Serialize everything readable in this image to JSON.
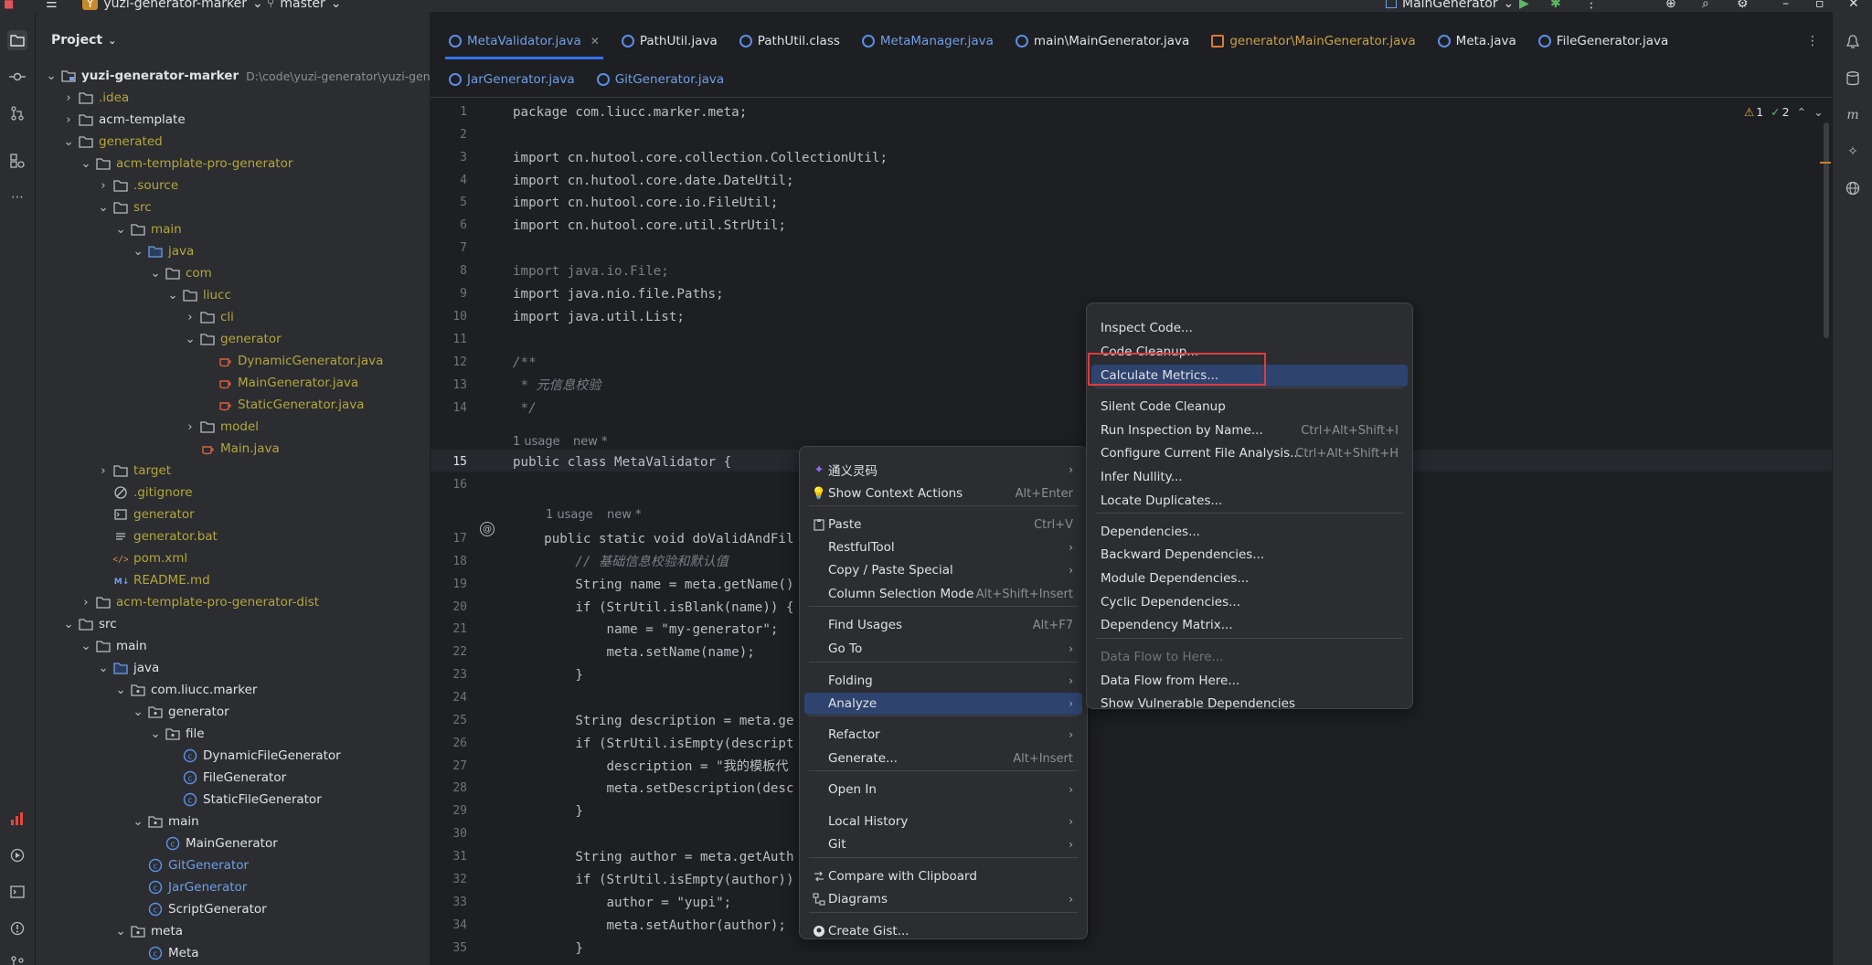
{
  "titlebar": {
    "project_badge": "Y",
    "project_name": "yuzi-generator-marker",
    "branch": "master",
    "run_config": "MainGenerator"
  },
  "project_panel": {
    "title": "Project",
    "root_name": "yuzi-generator-marker",
    "root_path": "D:\\code\\yuzi-generator\\yuzi-genera",
    "items": [
      {
        "label": ".idea",
        "color": "yellow"
      },
      {
        "label": "acm-template",
        "color": "normal"
      },
      {
        "label": "generated",
        "color": "yellow"
      },
      {
        "label": "acm-template-pro-generator",
        "color": "yellow"
      },
      {
        "label": ".source",
        "color": "yellow"
      },
      {
        "label": "src",
        "color": "yellow"
      },
      {
        "label": "main",
        "color": "yellow"
      },
      {
        "label": "java",
        "color": "yellow"
      },
      {
        "label": "com",
        "color": "yellow"
      },
      {
        "label": "liucc",
        "color": "yellow"
      },
      {
        "label": "cli",
        "color": "yellow"
      },
      {
        "label": "generator",
        "color": "yellow"
      },
      {
        "label": "DynamicGenerator.java",
        "color": "yellow"
      },
      {
        "label": "MainGenerator.java",
        "color": "yellow"
      },
      {
        "label": "StaticGenerator.java",
        "color": "yellow"
      },
      {
        "label": "model",
        "color": "yellow"
      },
      {
        "label": "Main.java",
        "color": "yellow"
      },
      {
        "label": "target",
        "color": "yellow"
      },
      {
        "label": ".gitignore",
        "color": "yellow"
      },
      {
        "label": "generator",
        "color": "yellow"
      },
      {
        "label": "generator.bat",
        "color": "yellow"
      },
      {
        "label": "pom.xml",
        "color": "yellow"
      },
      {
        "label": "README.md",
        "color": "yellow"
      },
      {
        "label": "acm-template-pro-generator-dist",
        "color": "yellow"
      },
      {
        "label": "src",
        "color": "normal"
      },
      {
        "label": "main",
        "color": "normal"
      },
      {
        "label": "java",
        "color": "normal"
      },
      {
        "label": "com.liucc.marker",
        "color": "normal"
      },
      {
        "label": "generator",
        "color": "normal"
      },
      {
        "label": "file",
        "color": "normal"
      },
      {
        "label": "DynamicFileGenerator",
        "color": "normal"
      },
      {
        "label": "FileGenerator",
        "color": "normal"
      },
      {
        "label": "StaticFileGenerator",
        "color": "normal"
      },
      {
        "label": "main",
        "color": "normal"
      },
      {
        "label": "MainGenerator",
        "color": "normal"
      },
      {
        "label": "GitGenerator",
        "color": "blue"
      },
      {
        "label": "JarGenerator",
        "color": "blue"
      },
      {
        "label": "ScriptGenerator",
        "color": "normal"
      },
      {
        "label": "meta",
        "color": "normal"
      },
      {
        "label": "Meta",
        "color": "normal"
      }
    ]
  },
  "tabs_row1": [
    {
      "label": "MetaValidator.java",
      "active": true,
      "color": "blue"
    },
    {
      "label": "PathUtil.java",
      "color": "normal"
    },
    {
      "label": "PathUtil.class",
      "color": "normal"
    },
    {
      "label": "MetaManager.java",
      "color": "blue"
    },
    {
      "label": "main\\MainGenerator.java",
      "color": "normal"
    },
    {
      "label": "generator\\MainGenerator.java",
      "color": "gold"
    },
    {
      "label": "Meta.java",
      "color": "normal"
    },
    {
      "label": "FileGenerator.java",
      "color": "normal"
    }
  ],
  "tabs_row2": [
    {
      "label": "JarGenerator.java",
      "color": "blue"
    },
    {
      "label": "GitGenerator.java",
      "color": "blue"
    }
  ],
  "editor": {
    "warnings": "1",
    "checks": "2",
    "usage1": "1 usage",
    "new1": "new *",
    "usage2": "1 usage",
    "new2": "new *",
    "lines": {
      "l1": "package com.liucc.marker.meta;",
      "l3": "import cn.hutool.core.collection.CollectionUtil;",
      "l4": "import cn.hutool.core.date.DateUtil;",
      "l5": "import cn.hutool.core.io.FileUtil;",
      "l6": "import cn.hutool.core.util.StrUtil;",
      "l8": "import java.io.File;",
      "l9": "import java.nio.file.Paths;",
      "l10": "import java.util.List;",
      "l12": "/**",
      "l13": " * 元信息校验",
      "l14": " */",
      "l15": "public class MetaValidator {",
      "l17": "    public static void doValidAndFil",
      "l18": "        // 基础信息校验和默认值",
      "l19": "        String name = meta.getName()",
      "l20": "        if (StrUtil.isBlank(name)) {",
      "l21": "            name = \"my-generator\";",
      "l22": "            meta.setName(name);",
      "l23": "        }",
      "l25": "        String description = meta.ge",
      "l26": "        if (StrUtil.isEmpty(descript",
      "l27": "            description = \"我的模板代",
      "l28": "            meta.setDescription(desc",
      "l29": "        }",
      "l31": "        String author = meta.getAuth",
      "l32": "        if (StrUtil.isEmpty(author))",
      "l33": "            author = \"yupi\";",
      "l34": "            meta.setAuthor(author);",
      "l35": "        }"
    }
  },
  "context_menu": {
    "items": [
      {
        "label": "通义灵码",
        "shortcut": "",
        "submenu": true,
        "icon": "tongyi-icon"
      },
      {
        "label": "Show Context Actions",
        "shortcut": "Alt+Enter",
        "icon": "bulb-icon"
      },
      {
        "label": "Paste",
        "shortcut": "Ctrl+V",
        "icon": "clipboard-icon"
      },
      {
        "label": "RestfulTool",
        "submenu": true
      },
      {
        "label": "Copy / Paste Special",
        "submenu": true
      },
      {
        "label": "Column Selection Mode",
        "shortcut": "Alt+Shift+Insert"
      },
      {
        "label": "Find Usages",
        "shortcut": "Alt+F7"
      },
      {
        "label": "Go To",
        "submenu": true
      },
      {
        "label": "Folding",
        "submenu": true
      },
      {
        "label": "Analyze",
        "submenu": true,
        "selected": true
      },
      {
        "label": "Refactor",
        "submenu": true
      },
      {
        "label": "Generate...",
        "shortcut": "Alt+Insert"
      },
      {
        "label": "Open In",
        "submenu": true
      },
      {
        "label": "Local History",
        "submenu": true
      },
      {
        "label": "Git",
        "submenu": true
      },
      {
        "label": "Compare with Clipboard",
        "icon": "compare-icon"
      },
      {
        "label": "Diagrams",
        "submenu": true,
        "icon": "diagram-icon"
      },
      {
        "label": "Create Gist...",
        "icon": "github-icon"
      }
    ]
  },
  "analyze_submenu": {
    "items": [
      {
        "label": "Inspect Code..."
      },
      {
        "label": "Code Cleanup..."
      },
      {
        "label": "Calculate Metrics...",
        "selected": true
      },
      {
        "label": "Silent Code Cleanup"
      },
      {
        "label": "Run Inspection by Name...",
        "shortcut": "Ctrl+Alt+Shift+I"
      },
      {
        "label": "Configure Current File Analysis...",
        "shortcut": "Ctrl+Alt+Shift+H"
      },
      {
        "label": "Infer Nullity..."
      },
      {
        "label": "Locate Duplicates..."
      },
      {
        "label": "Dependencies..."
      },
      {
        "label": "Backward Dependencies..."
      },
      {
        "label": "Module Dependencies..."
      },
      {
        "label": "Cyclic Dependencies..."
      },
      {
        "label": "Dependency Matrix..."
      },
      {
        "label": "Data Flow to Here...",
        "disabled": true
      },
      {
        "label": "Data Flow from Here..."
      },
      {
        "label": "Show Vulnerable Dependencies"
      }
    ]
  },
  "colors": {
    "accent": "#3574f0",
    "selection": "#2e436e",
    "highlight_box": "#e03b3b"
  }
}
